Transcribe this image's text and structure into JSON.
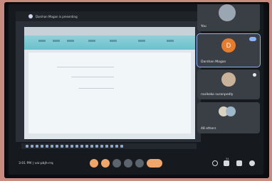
{
  "presentation": {
    "title": "Darshan Mogan is presenting"
  },
  "participants": [
    {
      "name": "You",
      "avatar_letter": ""
    },
    {
      "name": "Darshan Mogan",
      "avatar_letter": "D",
      "avatar_color": "#e67c2e"
    },
    {
      "name": "ravikeko suranpedly",
      "avatar_letter": ""
    },
    {
      "name": "48 others",
      "avatar_letter": ""
    }
  ],
  "meeting": {
    "time_and_code": "3:01 PM | vai-pbjh-rrq"
  },
  "colors": {
    "control_orange": "#f0a56a",
    "accent_blue": "#8ab4f8"
  },
  "icons": {
    "controls": [
      "mic-icon",
      "camera-icon",
      "captions-icon",
      "present-icon",
      "more-icon",
      "end-call-icon"
    ],
    "right": [
      "info-icon",
      "people-icon",
      "chat-icon",
      "activities-icon"
    ],
    "people_count": "54"
  }
}
